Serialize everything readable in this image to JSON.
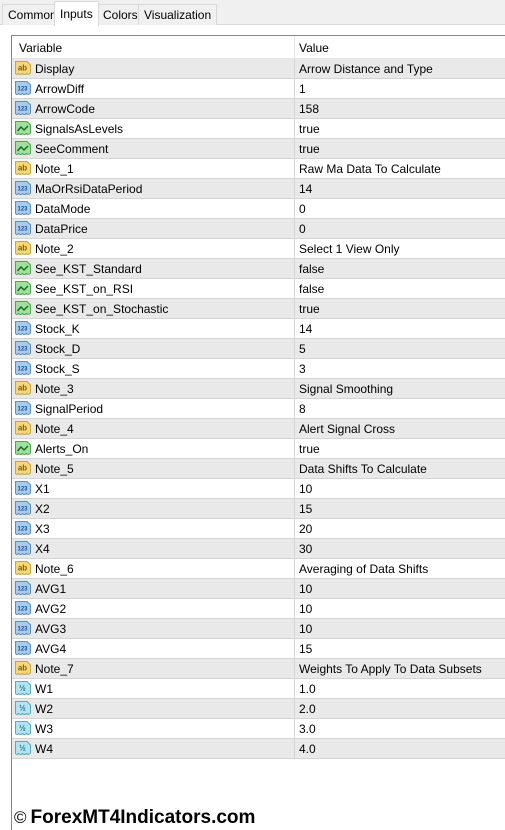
{
  "tabs": [
    {
      "label": "Common",
      "active": false
    },
    {
      "label": "Inputs",
      "active": true
    },
    {
      "label": "Colors",
      "active": false
    },
    {
      "label": "Visualization",
      "active": false
    }
  ],
  "columns": {
    "variable": "Variable",
    "value": "Value"
  },
  "icon_types": {
    "string": {
      "semantic": "string-type-icon",
      "glyph": "ab",
      "color": "#f3d97a",
      "border": "#c9a63a",
      "text": "#8a5a00"
    },
    "int": {
      "semantic": "integer-type-icon",
      "glyph": "123",
      "color": "#a8cbef",
      "border": "#5b8cc4",
      "text": "#1a4f99"
    },
    "bool": {
      "semantic": "boolean-type-icon",
      "glyph": "~",
      "color": "#9fe09f",
      "border": "#4aa84a",
      "text": "#1f6e1f"
    },
    "double": {
      "semantic": "double-type-icon",
      "glyph": "½",
      "color": "#b5e3ef",
      "border": "#55a9c4",
      "text": "#1d6f8c"
    }
  },
  "rows": [
    {
      "type": "string",
      "name": "Display",
      "value": "Arrow Distance and Type"
    },
    {
      "type": "int",
      "name": "ArrowDiff",
      "value": "1"
    },
    {
      "type": "int",
      "name": "ArrowCode",
      "value": "158"
    },
    {
      "type": "bool",
      "name": "SignalsAsLevels",
      "value": "true"
    },
    {
      "type": "bool",
      "name": "SeeComment",
      "value": "true"
    },
    {
      "type": "string",
      "name": "Note_1",
      "value": "Raw Ma Data To Calculate"
    },
    {
      "type": "int",
      "name": "MaOrRsiDataPeriod",
      "value": "14"
    },
    {
      "type": "int",
      "name": "DataMode",
      "value": "0"
    },
    {
      "type": "int",
      "name": "DataPrice",
      "value": "0"
    },
    {
      "type": "string",
      "name": "Note_2",
      "value": "Select 1 View Only"
    },
    {
      "type": "bool",
      "name": "See_KST_Standard",
      "value": "false"
    },
    {
      "type": "bool",
      "name": "See_KST_on_RSI",
      "value": "false"
    },
    {
      "type": "bool",
      "name": "See_KST_on_Stochastic",
      "value": "true"
    },
    {
      "type": "int",
      "name": "Stock_K",
      "value": "14"
    },
    {
      "type": "int",
      "name": "Stock_D",
      "value": "5"
    },
    {
      "type": "int",
      "name": "Stock_S",
      "value": "3"
    },
    {
      "type": "string",
      "name": "Note_3",
      "value": "Signal Smoothing"
    },
    {
      "type": "int",
      "name": "SignalPeriod",
      "value": "8"
    },
    {
      "type": "string",
      "name": "Note_4",
      "value": "Alert Signal Cross"
    },
    {
      "type": "bool",
      "name": "Alerts_On",
      "value": "true"
    },
    {
      "type": "string",
      "name": "Note_5",
      "value": "Data Shifts To Calculate"
    },
    {
      "type": "int",
      "name": "X1",
      "value": "10"
    },
    {
      "type": "int",
      "name": "X2",
      "value": "15"
    },
    {
      "type": "int",
      "name": "X3",
      "value": "20"
    },
    {
      "type": "int",
      "name": "X4",
      "value": "30"
    },
    {
      "type": "string",
      "name": "Note_6",
      "value": "Averaging of Data Shifts"
    },
    {
      "type": "int",
      "name": "AVG1",
      "value": "10"
    },
    {
      "type": "int",
      "name": "AVG2",
      "value": "10"
    },
    {
      "type": "int",
      "name": "AVG3",
      "value": "10"
    },
    {
      "type": "int",
      "name": "AVG4",
      "value": "15"
    },
    {
      "type": "string",
      "name": "Note_7",
      "value": "Weights To Apply To Data Subsets"
    },
    {
      "type": "double",
      "name": "W1",
      "value": "1.0"
    },
    {
      "type": "double",
      "name": "W2",
      "value": "2.0"
    },
    {
      "type": "double",
      "name": "W3",
      "value": "3.0"
    },
    {
      "type": "double",
      "name": "W4",
      "value": "4.0"
    }
  ],
  "watermark": {
    "symbol": "©",
    "text": "ForexMT4Indicators.com"
  }
}
